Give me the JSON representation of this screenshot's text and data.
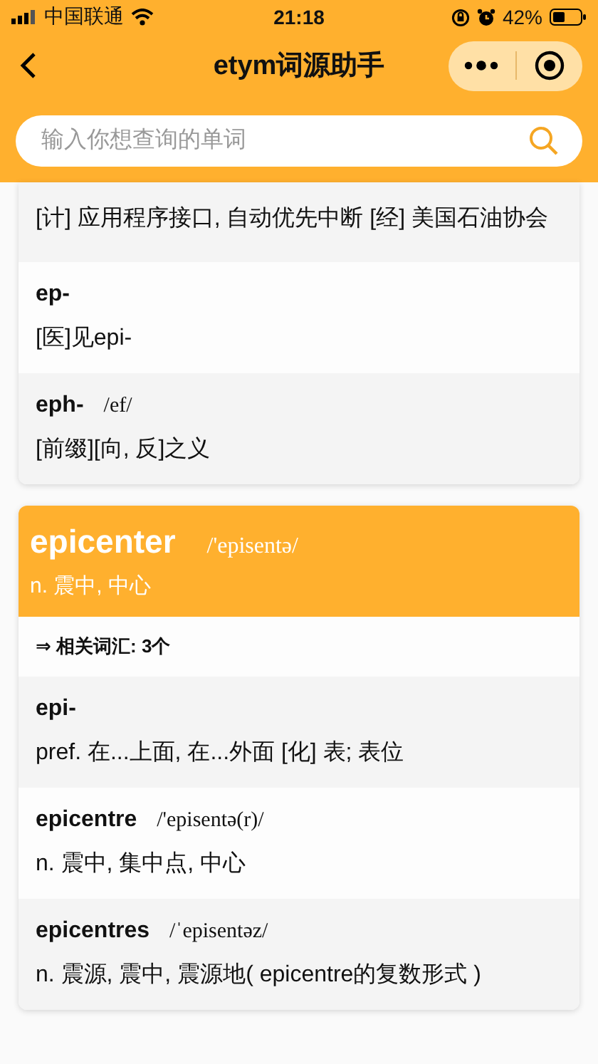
{
  "status_bar": {
    "carrier": "中国联通",
    "time": "21:18",
    "battery": "42%"
  },
  "nav": {
    "title": "etym词源助手"
  },
  "search": {
    "placeholder": "输入你想查询的单词"
  },
  "previous_card": {
    "rows": [
      {
        "definition": "[计] 应用程序接口, 自动优先中断 [经] 美国石油协会"
      },
      {
        "word": "ep-",
        "definition": "[医]见epi-"
      },
      {
        "word": "eph-",
        "phonetic": "/ef/",
        "definition": "[前缀][向, 反]之义"
      }
    ]
  },
  "entry": {
    "word": "epicenter",
    "phonetic": "/'episentə/",
    "definition": "n. 震中, 中心",
    "related": "⇒ 相关词汇: 3个",
    "rows": [
      {
        "word": "epi-",
        "definition": "pref. 在...上面, 在...外面 [化] 表; 表位"
      },
      {
        "word": "epicentre",
        "phonetic": "/'episentə(r)/",
        "definition": "n. 震中, 集中点, 中心"
      },
      {
        "word": "epicentres",
        "phonetic": "/ˈepisentəz/",
        "definition": "n. 震源, 震中, 震源地( epicentre的复数形式 )"
      }
    ]
  }
}
